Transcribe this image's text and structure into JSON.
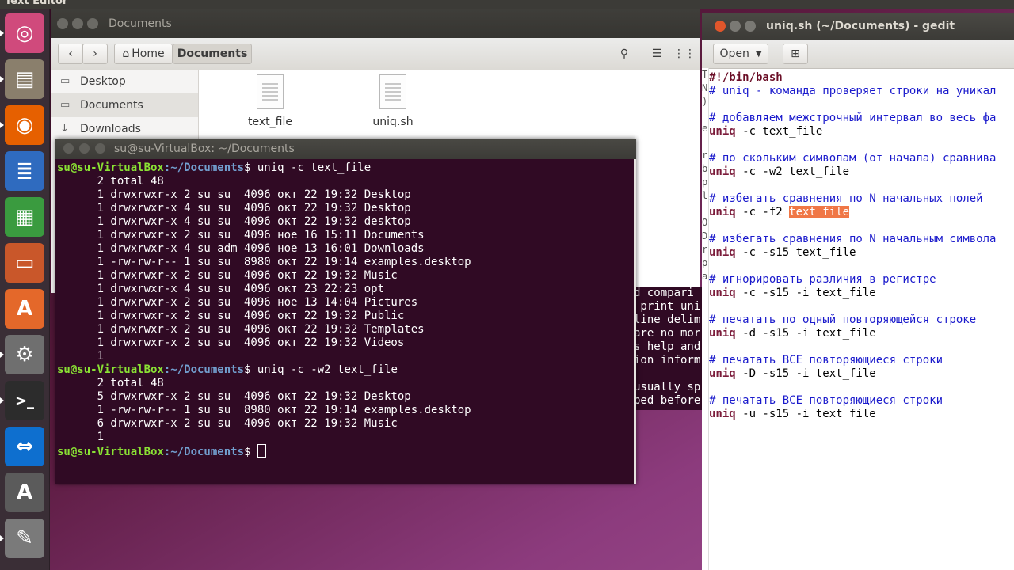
{
  "top_panel": {
    "title": "Text Editor"
  },
  "launcher": {
    "items": [
      {
        "name": "ubuntu-dash-icon",
        "glyph": "◎",
        "color": "#d04a7c"
      },
      {
        "name": "file-manager-icon",
        "glyph": "▤",
        "color": "#8a7f6c"
      },
      {
        "name": "firefox-icon",
        "glyph": "◉",
        "color": "#e66000"
      },
      {
        "name": "writer-icon",
        "glyph": "≣",
        "color": "#2f6bbf"
      },
      {
        "name": "calc-icon",
        "glyph": "▦",
        "color": "#3a9b3f"
      },
      {
        "name": "impress-icon",
        "glyph": "▭",
        "color": "#c9572a"
      },
      {
        "name": "software-center-icon",
        "glyph": "A",
        "color": "#e4682a"
      },
      {
        "name": "system-settings-icon",
        "glyph": "⚙",
        "color": "#6f6f6f"
      },
      {
        "name": "terminal-icon",
        "glyph": ">_",
        "color": "#2c2c2c"
      },
      {
        "name": "teamviewer-icon",
        "glyph": "⇔",
        "color": "#0e6fcf"
      },
      {
        "name": "software-updater-icon",
        "glyph": "A",
        "color": "#5b5b5b"
      },
      {
        "name": "text-editor-icon",
        "glyph": "✎",
        "color": "#7a7a7a"
      }
    ]
  },
  "files": {
    "window_title": "Documents",
    "breadcrumb_home": "Home",
    "breadcrumb_current": "Documents",
    "sidebar": [
      {
        "label": "Desktop",
        "icon": "▭"
      },
      {
        "label": "Documents",
        "icon": "▭"
      },
      {
        "label": "Downloads",
        "icon": "↓"
      }
    ],
    "items": [
      {
        "label": "text_file"
      },
      {
        "label": "uniq.sh"
      }
    ]
  },
  "manpage": {
    "lines": [
      "d compari",
      " print uni",
      "line delim",
      "are no mor",
      "s help and",
      "ion inform",
      "",
      "usually sp",
      "ped before"
    ]
  },
  "terminal": {
    "title": "su@su-VirtualBox: ~/Documents",
    "prompt_user": "su@su-VirtualBox",
    "prompt_path": ":~/Documents",
    "prompt_symbol": "$ ",
    "cmd1": "uniq -c text_file",
    "output1": [
      "      2 total 48",
      "      1 drwxrwxr-x 2 su su  4096 окт 22 19:32 Desktop",
      "      1 drwxrwxr-x 4 su su  4096 окт 22 19:32 Desktop",
      "      1 drwxrwxr-x 4 su su  4096 окт 22 19:32 desktop",
      "      1 drwxrwxr-x 2 su su  4096 ноe 16 15:11 Documents",
      "      1 drwxrwxr-x 4 su adm 4096 ноe 13 16:01 Downloads",
      "      1 -rw-rw-r-- 1 su su  8980 окт 22 19:14 examples.desktop",
      "      1 drwxrwxr-x 2 su su  4096 окт 22 19:32 Music",
      "      1 drwxrwxr-x 4 su su  4096 окт 23 22:23 opt",
      "      1 drwxrwxr-x 2 su su  4096 ноe 13 14:04 Pictures",
      "      1 drwxrwxr-x 2 su su  4096 окт 22 19:32 Public",
      "      1 drwxrwxr-x 2 su su  4096 окт 22 19:32 Templates",
      "      1 drwxrwxr-x 2 su su  4096 окт 22 19:32 Videos",
      "      1"
    ],
    "cmd2": "uniq -c -w2 text_file",
    "output2": [
      "      2 total 48",
      "      5 drwxrwxr-x 2 su su  4096 окт 22 19:32 Desktop",
      "      1 -rw-rw-r-- 1 su su  8980 окт 22 19:14 examples.desktop",
      "      6 drwxrwxr-x 2 su su  4096 окт 22 19:32 Music",
      "      1"
    ]
  },
  "gedit": {
    "title": "uniq.sh (~/Documents) - gedit",
    "open_label": "Open",
    "left_edge": [
      "T",
      "N",
      ")",
      "",
      "e",
      "",
      "r",
      "b",
      "p",
      "l",
      "",
      "O",
      "D",
      "r",
      "p",
      "a",
      "",
      "",
      "",
      "",
      "",
      "",
      "",
      "",
      "",
      "",
      ""
    ],
    "lines": [
      {
        "type": "shebang",
        "text": "#!/bin/bash"
      },
      {
        "type": "comment",
        "text": "# uniq - команда проверяет строки на уникал"
      },
      {
        "type": "blank",
        "text": ""
      },
      {
        "type": "comment",
        "text": "# добавляем межстрочный интервал во весь фа"
      },
      {
        "type": "code",
        "kw": "uniq",
        "text": " -c text_file"
      },
      {
        "type": "blank",
        "text": ""
      },
      {
        "type": "comment",
        "text": "# по скольким символам (от начала) сравнива"
      },
      {
        "type": "code",
        "kw": "uniq",
        "text": " -c -w2 text_file"
      },
      {
        "type": "blank",
        "text": ""
      },
      {
        "type": "comment",
        "text": "# избегать сравнения по N начальных полей"
      },
      {
        "type": "code_hl",
        "kw": "uniq",
        "text": " -c -f2 ",
        "hl": "text_file"
      },
      {
        "type": "blank",
        "text": ""
      },
      {
        "type": "comment",
        "text": "# избегать сравнения по N начальным символа"
      },
      {
        "type": "code",
        "kw": "uniq",
        "text": " -c -s15 text_file"
      },
      {
        "type": "blank",
        "text": ""
      },
      {
        "type": "comment",
        "text": "# игнорировать различия в регистре"
      },
      {
        "type": "code",
        "kw": "uniq",
        "text": " -c -s15 -i text_file"
      },
      {
        "type": "blank",
        "text": ""
      },
      {
        "type": "comment",
        "text": "# печатать по одный повторяющейся строке"
      },
      {
        "type": "code",
        "kw": "uniq",
        "text": " -d -s15 -i text_file"
      },
      {
        "type": "blank",
        "text": ""
      },
      {
        "type": "comment",
        "text": "# печатать ВСЕ повторяющиеся строки"
      },
      {
        "type": "code",
        "kw": "uniq",
        "text": " -D -s15 -i text_file"
      },
      {
        "type": "blank",
        "text": ""
      },
      {
        "type": "comment",
        "text": "# печатать ВСЕ повторяющиеся строки"
      },
      {
        "type": "code",
        "kw": "uniq",
        "text": " -u -s15 -i text_file"
      }
    ]
  }
}
